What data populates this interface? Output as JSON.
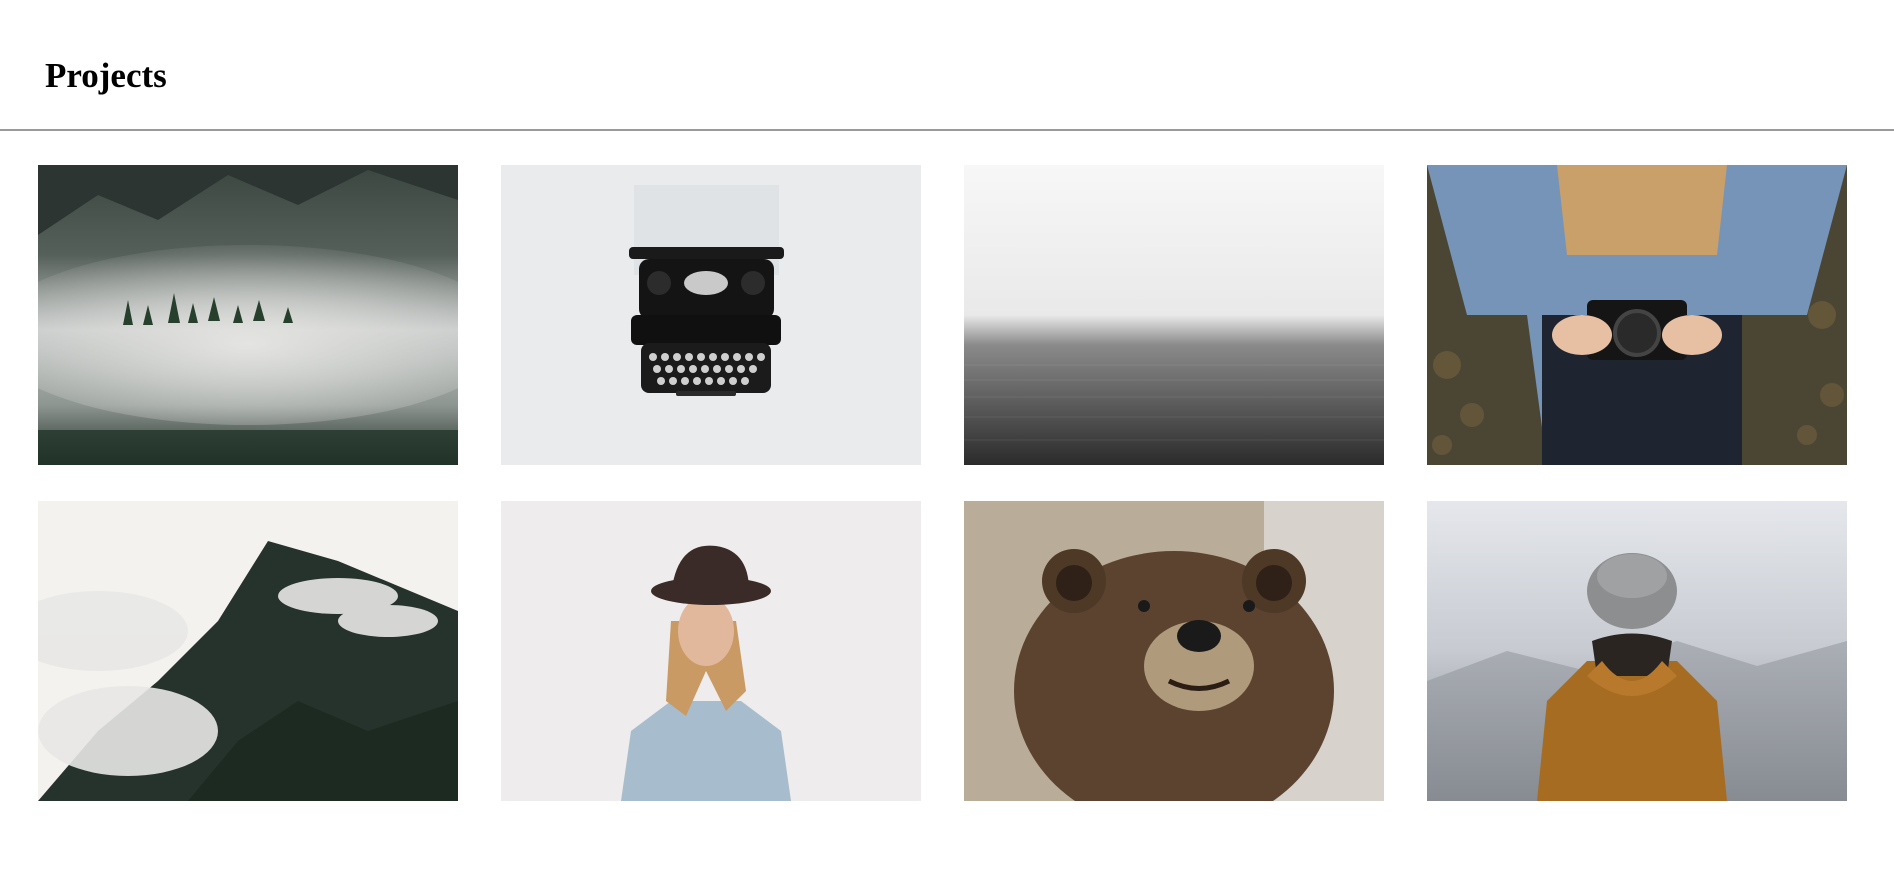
{
  "header": {
    "title": "Projects"
  },
  "gallery": {
    "items": [
      {
        "subject": "misty-forest-lake",
        "palette": [
          "#2f3a36",
          "#c9cbca",
          "#1f2d25"
        ]
      },
      {
        "subject": "typewriter",
        "palette": [
          "#e9ebec",
          "#111111",
          "#dfe3e6"
        ]
      },
      {
        "subject": "foggy-sea",
        "palette": [
          "#f4f4f4",
          "#4a4a4a",
          "#2b2b2b"
        ]
      },
      {
        "subject": "woman-with-camera",
        "palette": [
          "#6f8fb3",
          "#c9a06a",
          "#1e2430"
        ]
      },
      {
        "subject": "cloudy-mountain",
        "palette": [
          "#f7f5f2",
          "#1f2a24",
          "#c9ccc8"
        ]
      },
      {
        "subject": "woman-with-hat",
        "palette": [
          "#eceaea",
          "#3a2b28",
          "#9db2c4"
        ]
      },
      {
        "subject": "brown-bear",
        "palette": [
          "#5b4330",
          "#c2b7a5",
          "#2d1f14"
        ]
      },
      {
        "subject": "person-in-hood",
        "palette": [
          "#cfd3da",
          "#a66c22",
          "#8f939a"
        ]
      }
    ]
  }
}
